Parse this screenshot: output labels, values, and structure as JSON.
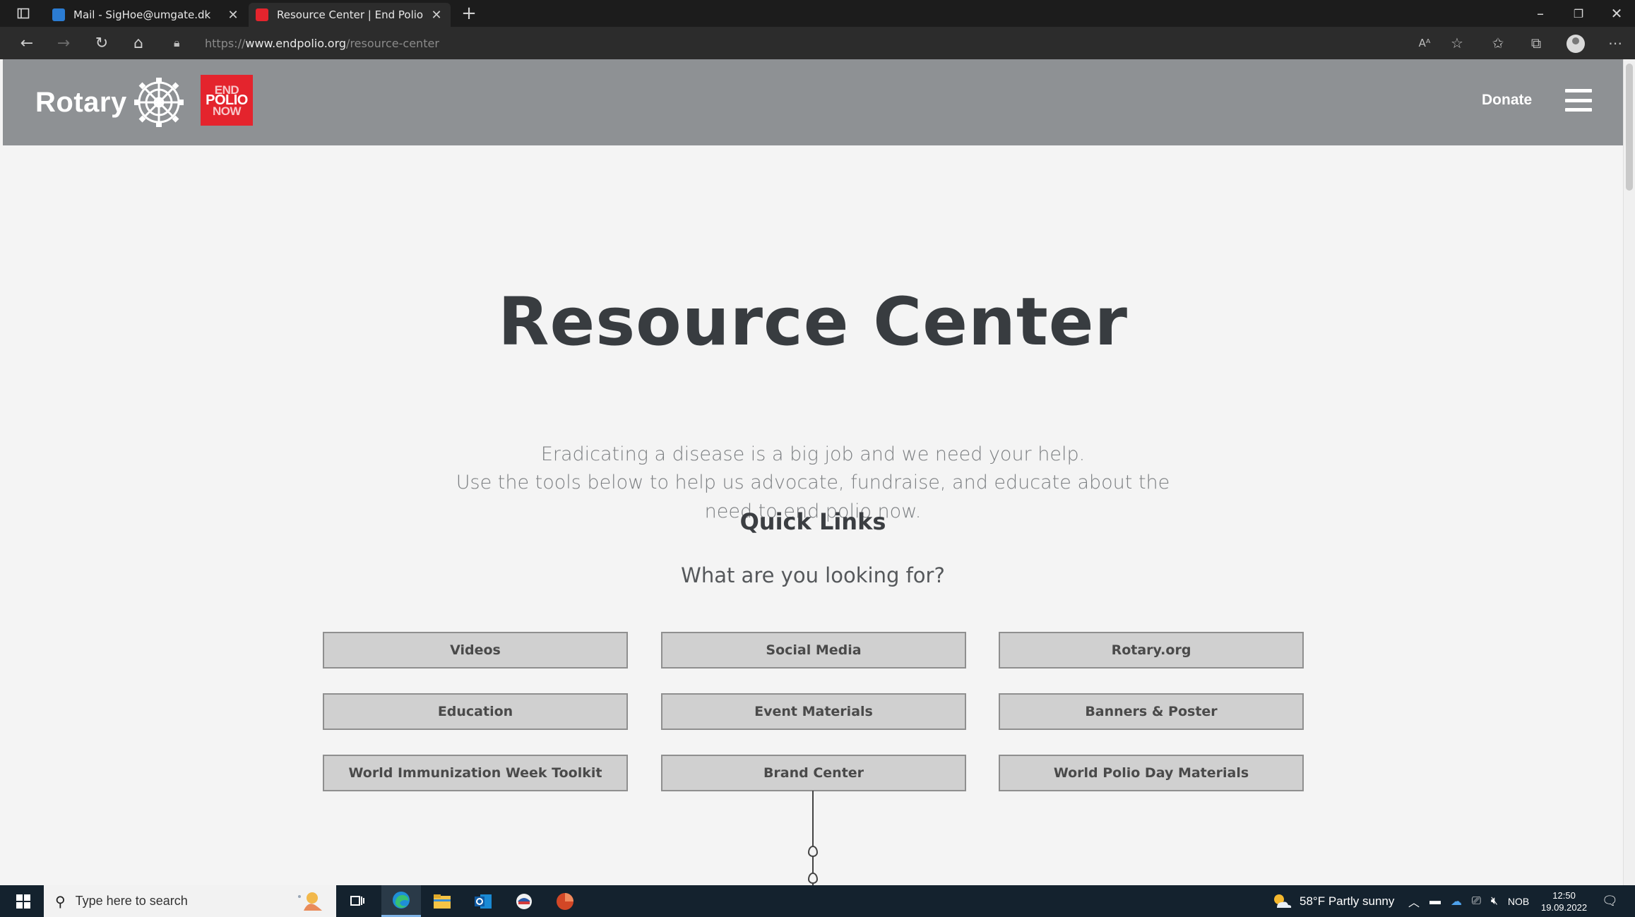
{
  "browser": {
    "tabs": [
      {
        "title": "Mail - SigHoe@umgate.dk",
        "active": false,
        "favicon_color": "#2b7cd3"
      },
      {
        "title": "Resource Center | End Polio",
        "active": true,
        "favicon_color": "#e4242d"
      }
    ],
    "url_scheme": "https://",
    "url_host": "www.endpolio.org",
    "url_path": "/resource-center",
    "toolbar_icons": [
      "read-aloud-icon",
      "add-favorite-icon",
      "favorites-icon",
      "collections-icon",
      "profile-icon",
      "more-icon"
    ]
  },
  "header": {
    "logo_text": "Rotary",
    "badge_lines": [
      "END",
      "POLIO",
      "NOW"
    ],
    "donate_label": "Donate"
  },
  "hero": {
    "title": "Resource Center",
    "subtitle_lines": [
      "Eradicating a disease is a big job and we need your help.",
      "Use the tools below to help us advocate, fundraise, and educate about the",
      "need to end polio now."
    ]
  },
  "quick_links": {
    "title": "Quick Links",
    "question": "What are you looking for?",
    "buttons": [
      "Videos",
      "Social Media",
      "Rotary.org",
      "Education",
      "Event Materials",
      "Banners & Poster",
      "World Immunization Week Toolkit",
      "Brand Center",
      "World Polio Day Materials"
    ]
  },
  "taskbar": {
    "search_placeholder": "Type here to search",
    "weather": "58°F  Partly sunny",
    "language": "NOB",
    "time": "12:50",
    "date": "19.09.2022"
  },
  "colors": {
    "header_bg": "#8e9194",
    "endpolio_red": "#e4242d",
    "title_text": "#383c40",
    "button_bg": "#d0d0d0"
  }
}
